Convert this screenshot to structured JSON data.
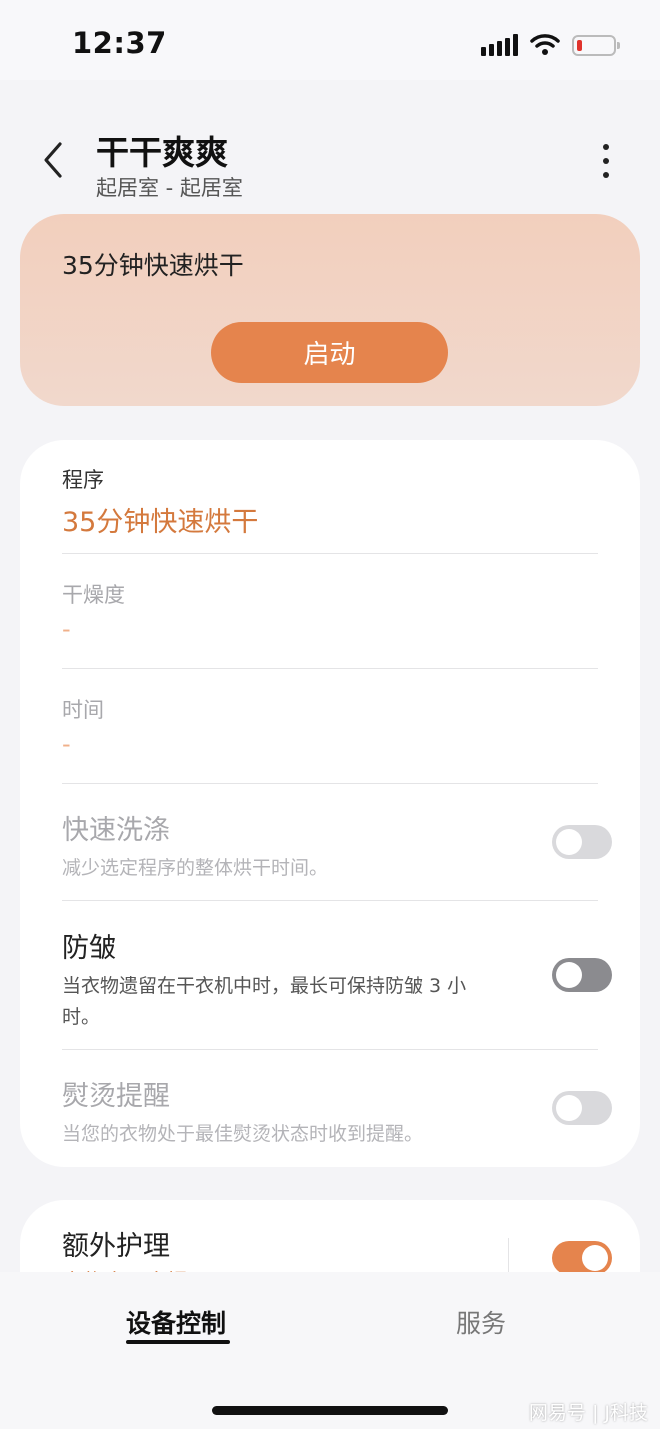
{
  "status_bar": {
    "time": "12:37",
    "icons": [
      "signal-icon",
      "wifi-icon",
      "battery-low-icon"
    ]
  },
  "header": {
    "title": "干干爽爽",
    "subtitle": "起居室 - 起居室",
    "back_icon": "chevron-left-icon",
    "more_icon": "more-vertical-icon"
  },
  "quick_card": {
    "title": "35分钟快速烘干",
    "start_label": "启动"
  },
  "settings": {
    "program": {
      "label": "程序",
      "value": "35分钟快速烘干"
    },
    "dryness": {
      "label": "干燥度",
      "value": "-"
    },
    "time": {
      "label": "时间",
      "value": "-"
    },
    "quick_wash": {
      "title": "快速洗涤",
      "desc": "减少选定程序的整体烘干时间。",
      "enabled": false
    },
    "anti_wrinkle": {
      "title": "防皱",
      "desc": "当衣物遗留在干衣机中时，最长可保持防皱 3 小时。",
      "enabled": false
    },
    "iron_reminder": {
      "title": "熨烫提醒",
      "desc": "当您的衣物处于最佳熨烫状态时收到提醒。",
      "enabled": false
    }
  },
  "extra_care": {
    "title": "额外护理",
    "sub": "衣物未取出提醒",
    "enabled": true
  },
  "bottom_nav": {
    "tabs": [
      {
        "label": "设备控制",
        "active": true
      },
      {
        "label": "服务",
        "active": false
      }
    ]
  },
  "watermark": "网易号 | J科技",
  "colors": {
    "accent": "#e5844d",
    "accent_text": "#d4793d",
    "card_tint": "#f2cfbd"
  }
}
